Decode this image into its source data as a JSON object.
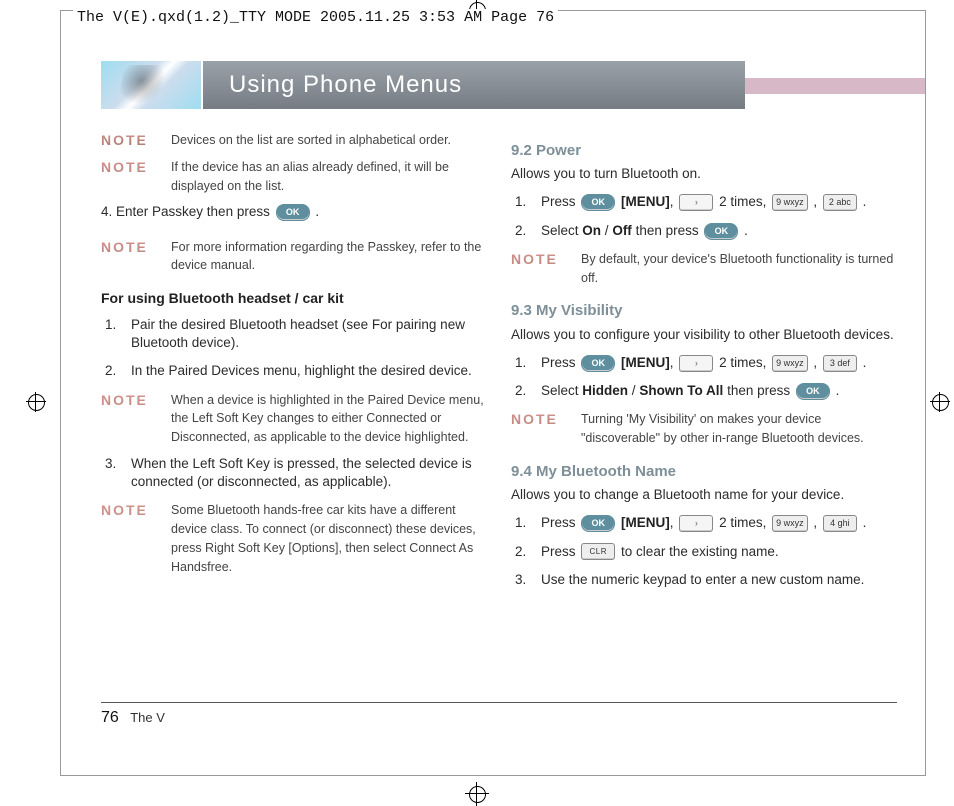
{
  "crop_header": "The V(E).qxd(1.2)_TTY MODE  2005.11.25  3:53 AM  Page 76",
  "header": {
    "title": "Using Phone Menus"
  },
  "left": {
    "note1": "Devices on the list are sorted in alphabetical order.",
    "note2": "If the device has an alias already defined, it will be displayed on the list.",
    "step4_a": "4. Enter Passkey then press ",
    "step4_b": " .",
    "note3": "For more information regarding the Passkey, refer to the device manual.",
    "subhead": "For using Bluetooth headset / car kit",
    "s1": "Pair the desired Bluetooth headset (see For pairing new Bluetooth device).",
    "s2": "In the Paired Devices menu, highlight the desired device.",
    "note4": "When a device is highlighted in the Paired Device menu, the Left Soft Key changes to either Connected or Disconnected, as applicable to the device highlighted.",
    "s3": "When the Left Soft Key is pressed, the selected device is connected (or disconnected, as applicable).",
    "note5": "Some Bluetooth hands-free car kits have a different device class. To connect (or disconnect) these devices, press Right Soft Key [Options], then select Connect As Handsfree."
  },
  "right": {
    "sec92": "9.2 Power",
    "p92": "Allows you to turn Bluetooth on.",
    "press": "Press",
    "menu": "[MENU]",
    "twotimes": " 2 times, ",
    "comma": " , ",
    "period": " .",
    "s92b_a": "Select ",
    "on": "On",
    "slash": " / ",
    "off": "Off",
    "thenpress": " then press ",
    "note92": "By default, your device's Bluetooth functionality is turned off.",
    "sec93": "9.3 My Visibility",
    "p93": "Allows you to configure your visibility to other Bluetooth devices.",
    "hidden": "Hidden",
    "shown": "Shown To All",
    "note93": "Turning 'My Visibility' on makes your device \"discoverable\" by other in-range Bluetooth devices.",
    "sec94": "9.4 My Bluetooth Name",
    "p94": "Allows you to change a Bluetooth name for your device.",
    "s94b": " to clear the existing name.",
    "s94c": "Use the numeric keypad to enter a new custom name."
  },
  "keys": {
    "ok": "OK",
    "k9": "9 wxyz",
    "k2": "2 abc",
    "k3": "3 def",
    "k4": "4 ghi",
    "clr": "CLR"
  },
  "labels": {
    "note": "NOTE",
    "one": "1.",
    "two": "2.",
    "three": "3."
  },
  "footer": {
    "page": "76",
    "book": "The V"
  }
}
